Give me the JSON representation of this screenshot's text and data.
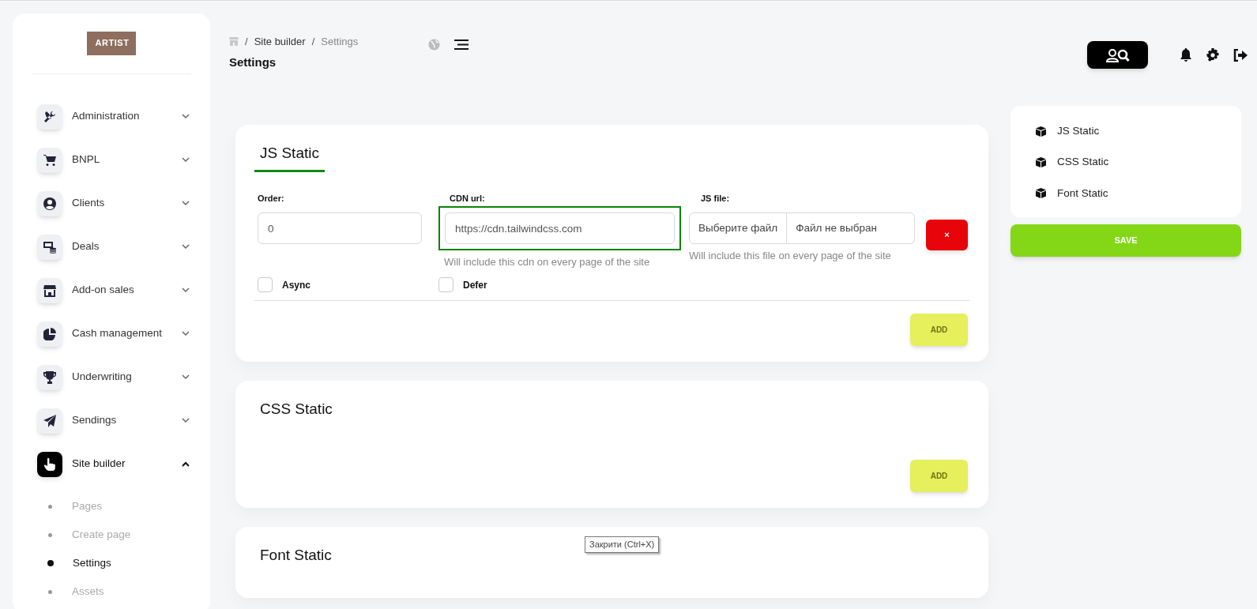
{
  "logo": {
    "text": "ARTIST"
  },
  "sidebar": {
    "items": [
      {
        "label": "Administration",
        "selected": false,
        "expanded": false
      },
      {
        "label": "BNPL",
        "selected": false,
        "expanded": false
      },
      {
        "label": "Clients",
        "selected": false,
        "expanded": false
      },
      {
        "label": "Deals",
        "selected": false,
        "expanded": false
      },
      {
        "label": "Add-on sales",
        "selected": false,
        "expanded": false
      },
      {
        "label": "Cash management",
        "selected": false,
        "expanded": false
      },
      {
        "label": "Underwriting",
        "selected": false,
        "expanded": false
      },
      {
        "label": "Sendings",
        "selected": false,
        "expanded": false
      },
      {
        "label": "Site builder",
        "selected": true,
        "expanded": true,
        "children": [
          {
            "label": "Pages",
            "selected": false
          },
          {
            "label": "Create page",
            "selected": false
          },
          {
            "label": "Settings",
            "selected": true
          },
          {
            "label": "Assets",
            "selected": false
          }
        ]
      }
    ]
  },
  "breadcrumb": [
    "Site builder",
    "Settings"
  ],
  "breadcrumb_separator": "/",
  "page_title": "Settings",
  "sections": [
    {
      "title": "JS Static",
      "selected": true,
      "fields": [
        {
          "kind": "text",
          "label": "Order:",
          "value": "0",
          "highlighted": false
        },
        {
          "kind": "text",
          "label": "CDN url:",
          "value": "https://cdn.tailwindcss.com",
          "highlighted": true,
          "hint": "Will include this cdn on every page of the site"
        },
        {
          "kind": "file",
          "label": "JS file:",
          "button": "Выберите файл",
          "status": "Файл не выбран",
          "hint": "Will include this file on every page of the site"
        }
      ],
      "remove_button": "×",
      "checkboxes": [
        {
          "label": "Async",
          "checked": false
        },
        {
          "label": "Defer",
          "checked": false
        }
      ],
      "add_button": "ADD"
    },
    {
      "title": "CSS Static",
      "selected": false,
      "add_button": "ADD"
    },
    {
      "title": "Font Static",
      "selected": false
    }
  ],
  "side_nav": [
    "JS Static",
    "CSS Static",
    "Font Static"
  ],
  "save_button": "SAVE",
  "tooltip": "Закрити (Ctrl+X)"
}
